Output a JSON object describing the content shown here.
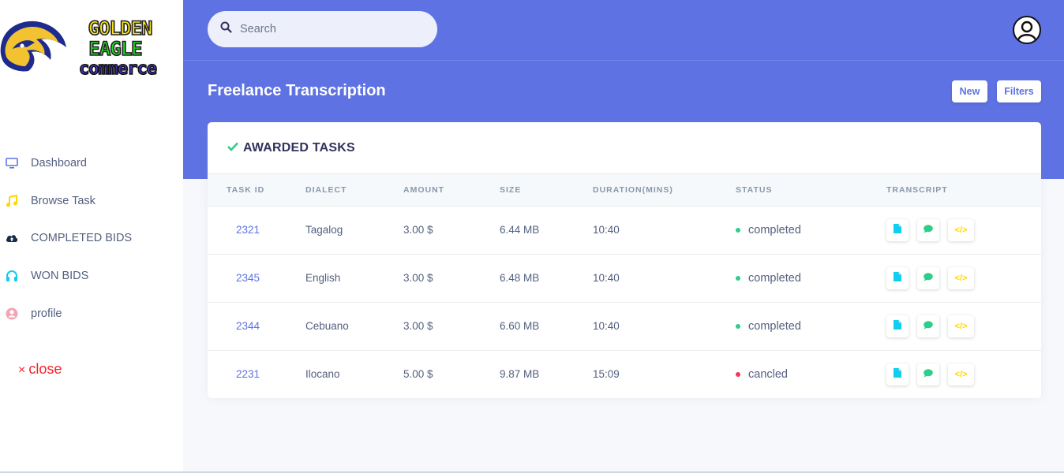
{
  "logo": {
    "line1": "GOLDEN",
    "line2": "EAGLE",
    "line3": "commerce"
  },
  "sidebar": {
    "items": [
      {
        "label": "Dashboard",
        "icon": "monitor-icon",
        "color": "#5e72e4"
      },
      {
        "label": "Browse Task",
        "icon": "music-icon",
        "color": "#ffd600"
      },
      {
        "label": "COMPLETED BIDS",
        "icon": "cloud-upload-icon",
        "color": "#172b4d"
      },
      {
        "label": "WON BIDS",
        "icon": "headphones-icon",
        "color": "#11cdef"
      },
      {
        "label": "profile",
        "icon": "user-icon",
        "color": "#f3a4b5"
      }
    ],
    "close_symbol": "×",
    "close_label": "close"
  },
  "search": {
    "placeholder": "Search"
  },
  "header": {
    "title": "Freelance Transcription",
    "new_label": "New",
    "filters_label": "Filters"
  },
  "card": {
    "title": "AWARDED TASKS",
    "columns": [
      "TASK ID",
      "DIALECT",
      "AMOUNT",
      "SIZE",
      "DURATION(MINS)",
      "STATUS",
      "TRANSCRIPT"
    ],
    "rows": [
      {
        "id": "2321",
        "dialect": "Tagalog",
        "amount": "3.00 $",
        "size": "6.44 MB",
        "duration": "10:40",
        "status": "completed",
        "status_color": "#2dce89"
      },
      {
        "id": "2345",
        "dialect": "English",
        "amount": "3.00 $",
        "size": "6.48 MB",
        "duration": "10:40",
        "status": "completed",
        "status_color": "#2dce89"
      },
      {
        "id": "2344",
        "dialect": "Cebuano",
        "amount": "3.00 $",
        "size": "6.60 MB",
        "duration": "10:40",
        "status": "completed",
        "status_color": "#2dce89"
      },
      {
        "id": "2231",
        "dialect": "Ilocano",
        "amount": "5.00 $",
        "size": "9.87 MB",
        "duration": "15:09",
        "status": "cancled",
        "status_color": "#f5365c"
      }
    ],
    "action_icons": [
      "file-icon",
      "comment-icon",
      "code-icon"
    ],
    "code_symbol": "</>"
  },
  "colors": {
    "primary": "#5e72e4",
    "success": "#2dce89",
    "danger": "#f5365c",
    "info": "#11cdef",
    "warning": "#ffd600"
  }
}
